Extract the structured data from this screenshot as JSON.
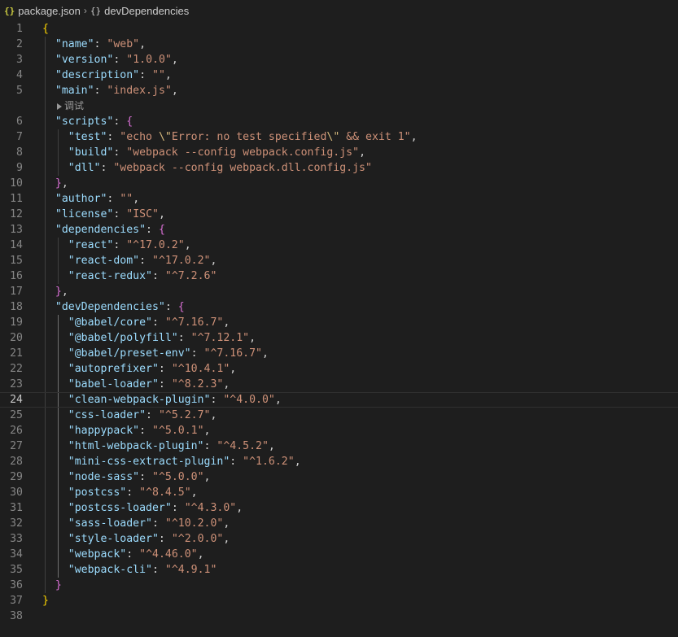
{
  "breadcrumb": {
    "file_icon": "{}",
    "file": "package.json",
    "separator": "›",
    "symbol_icon": "{}",
    "symbol": "devDependencies"
  },
  "codelens": "调试",
  "editor": {
    "current_line": 24,
    "lines": [
      {
        "n": "1",
        "t": [
          [
            "b1",
            "{"
          ]
        ]
      },
      {
        "n": "2",
        "t": [
          [
            "p",
            "  "
          ],
          [
            "k",
            "\"name\""
          ],
          [
            "p",
            ": "
          ],
          [
            "s",
            "\"web\""
          ],
          [
            "p",
            ","
          ]
        ]
      },
      {
        "n": "3",
        "t": [
          [
            "p",
            "  "
          ],
          [
            "k",
            "\"version\""
          ],
          [
            "p",
            ": "
          ],
          [
            "s",
            "\"1.0.0\""
          ],
          [
            "p",
            ","
          ]
        ]
      },
      {
        "n": "4",
        "t": [
          [
            "p",
            "  "
          ],
          [
            "k",
            "\"description\""
          ],
          [
            "p",
            ": "
          ],
          [
            "s",
            "\"\""
          ],
          [
            "p",
            ","
          ]
        ]
      },
      {
        "n": "5",
        "t": [
          [
            "p",
            "  "
          ],
          [
            "k",
            "\"main\""
          ],
          [
            "p",
            ": "
          ],
          [
            "s",
            "\"index.js\""
          ],
          [
            "p",
            ","
          ]
        ]
      },
      {
        "n": "6",
        "t": [
          [
            "p",
            "  "
          ],
          [
            "k",
            "\"scripts\""
          ],
          [
            "p",
            ": "
          ],
          [
            "b2",
            "{"
          ]
        ]
      },
      {
        "n": "7",
        "t": [
          [
            "p",
            "    "
          ],
          [
            "k",
            "\"test\""
          ],
          [
            "p",
            ": "
          ],
          [
            "s",
            "\"echo "
          ],
          [
            "e",
            "\\\""
          ],
          [
            "s",
            "Error: no test specified"
          ],
          [
            "e",
            "\\\""
          ],
          [
            "s",
            " && exit 1\""
          ],
          [
            "p",
            ","
          ]
        ]
      },
      {
        "n": "8",
        "t": [
          [
            "p",
            "    "
          ],
          [
            "k",
            "\"build\""
          ],
          [
            "p",
            ": "
          ],
          [
            "s",
            "\"webpack --config webpack.config.js\""
          ],
          [
            "p",
            ","
          ]
        ]
      },
      {
        "n": "9",
        "t": [
          [
            "p",
            "    "
          ],
          [
            "k",
            "\"dll\""
          ],
          [
            "p",
            ": "
          ],
          [
            "s",
            "\"webpack --config webpack.dll.config.js\""
          ]
        ]
      },
      {
        "n": "10",
        "t": [
          [
            "p",
            "  "
          ],
          [
            "b2",
            "}"
          ],
          [
            "p",
            ","
          ]
        ]
      },
      {
        "n": "11",
        "t": [
          [
            "p",
            "  "
          ],
          [
            "k",
            "\"author\""
          ],
          [
            "p",
            ": "
          ],
          [
            "s",
            "\"\""
          ],
          [
            "p",
            ","
          ]
        ]
      },
      {
        "n": "12",
        "t": [
          [
            "p",
            "  "
          ],
          [
            "k",
            "\"license\""
          ],
          [
            "p",
            ": "
          ],
          [
            "s",
            "\"ISC\""
          ],
          [
            "p",
            ","
          ]
        ]
      },
      {
        "n": "13",
        "t": [
          [
            "p",
            "  "
          ],
          [
            "k",
            "\"dependencies\""
          ],
          [
            "p",
            ": "
          ],
          [
            "b2",
            "{"
          ]
        ]
      },
      {
        "n": "14",
        "t": [
          [
            "p",
            "    "
          ],
          [
            "k",
            "\"react\""
          ],
          [
            "p",
            ": "
          ],
          [
            "s",
            "\"^17.0.2\""
          ],
          [
            "p",
            ","
          ]
        ]
      },
      {
        "n": "15",
        "t": [
          [
            "p",
            "    "
          ],
          [
            "k",
            "\"react-dom\""
          ],
          [
            "p",
            ": "
          ],
          [
            "s",
            "\"^17.0.2\""
          ],
          [
            "p",
            ","
          ]
        ]
      },
      {
        "n": "16",
        "t": [
          [
            "p",
            "    "
          ],
          [
            "k",
            "\"react-redux\""
          ],
          [
            "p",
            ": "
          ],
          [
            "s",
            "\"^7.2.6\""
          ]
        ]
      },
      {
        "n": "17",
        "t": [
          [
            "p",
            "  "
          ],
          [
            "b2",
            "}"
          ],
          [
            "p",
            ","
          ]
        ]
      },
      {
        "n": "18",
        "t": [
          [
            "p",
            "  "
          ],
          [
            "k",
            "\"devDependencies\""
          ],
          [
            "p",
            ": "
          ],
          [
            "b2",
            "{"
          ]
        ]
      },
      {
        "n": "19",
        "t": [
          [
            "p",
            "    "
          ],
          [
            "k",
            "\"@babel/core\""
          ],
          [
            "p",
            ": "
          ],
          [
            "s",
            "\"^7.16.7\""
          ],
          [
            "p",
            ","
          ]
        ]
      },
      {
        "n": "20",
        "t": [
          [
            "p",
            "    "
          ],
          [
            "k",
            "\"@babel/polyfill\""
          ],
          [
            "p",
            ": "
          ],
          [
            "s",
            "\"^7.12.1\""
          ],
          [
            "p",
            ","
          ]
        ]
      },
      {
        "n": "21",
        "t": [
          [
            "p",
            "    "
          ],
          [
            "k",
            "\"@babel/preset-env\""
          ],
          [
            "p",
            ": "
          ],
          [
            "s",
            "\"^7.16.7\""
          ],
          [
            "p",
            ","
          ]
        ]
      },
      {
        "n": "22",
        "t": [
          [
            "p",
            "    "
          ],
          [
            "k",
            "\"autoprefixer\""
          ],
          [
            "p",
            ": "
          ],
          [
            "s",
            "\"^10.4.1\""
          ],
          [
            "p",
            ","
          ]
        ]
      },
      {
        "n": "23",
        "t": [
          [
            "p",
            "    "
          ],
          [
            "k",
            "\"babel-loader\""
          ],
          [
            "p",
            ": "
          ],
          [
            "s",
            "\"^8.2.3\""
          ],
          [
            "p",
            ","
          ]
        ]
      },
      {
        "n": "24",
        "t": [
          [
            "p",
            "    "
          ],
          [
            "k",
            "\"clean-webpack-plugin\""
          ],
          [
            "p",
            ": "
          ],
          [
            "s",
            "\"^4.0.0\""
          ],
          [
            "p",
            ","
          ]
        ]
      },
      {
        "n": "25",
        "t": [
          [
            "p",
            "    "
          ],
          [
            "k",
            "\"css-loader\""
          ],
          [
            "p",
            ": "
          ],
          [
            "s",
            "\"^5.2.7\""
          ],
          [
            "p",
            ","
          ]
        ]
      },
      {
        "n": "26",
        "t": [
          [
            "p",
            "    "
          ],
          [
            "k",
            "\"happypack\""
          ],
          [
            "p",
            ": "
          ],
          [
            "s",
            "\"^5.0.1\""
          ],
          [
            "p",
            ","
          ]
        ]
      },
      {
        "n": "27",
        "t": [
          [
            "p",
            "    "
          ],
          [
            "k",
            "\"html-webpack-plugin\""
          ],
          [
            "p",
            ": "
          ],
          [
            "s",
            "\"^4.5.2\""
          ],
          [
            "p",
            ","
          ]
        ]
      },
      {
        "n": "28",
        "t": [
          [
            "p",
            "    "
          ],
          [
            "k",
            "\"mini-css-extract-plugin\""
          ],
          [
            "p",
            ": "
          ],
          [
            "s",
            "\"^1.6.2\""
          ],
          [
            "p",
            ","
          ]
        ]
      },
      {
        "n": "29",
        "t": [
          [
            "p",
            "    "
          ],
          [
            "k",
            "\"node-sass\""
          ],
          [
            "p",
            ": "
          ],
          [
            "s",
            "\"^5.0.0\""
          ],
          [
            "p",
            ","
          ]
        ]
      },
      {
        "n": "30",
        "t": [
          [
            "p",
            "    "
          ],
          [
            "k",
            "\"postcss\""
          ],
          [
            "p",
            ": "
          ],
          [
            "s",
            "\"^8.4.5\""
          ],
          [
            "p",
            ","
          ]
        ]
      },
      {
        "n": "31",
        "t": [
          [
            "p",
            "    "
          ],
          [
            "k",
            "\"postcss-loader\""
          ],
          [
            "p",
            ": "
          ],
          [
            "s",
            "\"^4.3.0\""
          ],
          [
            "p",
            ","
          ]
        ]
      },
      {
        "n": "32",
        "t": [
          [
            "p",
            "    "
          ],
          [
            "k",
            "\"sass-loader\""
          ],
          [
            "p",
            ": "
          ],
          [
            "s",
            "\"^10.2.0\""
          ],
          [
            "p",
            ","
          ]
        ]
      },
      {
        "n": "33",
        "t": [
          [
            "p",
            "    "
          ],
          [
            "k",
            "\"style-loader\""
          ],
          [
            "p",
            ": "
          ],
          [
            "s",
            "\"^2.0.0\""
          ],
          [
            "p",
            ","
          ]
        ]
      },
      {
        "n": "34",
        "t": [
          [
            "p",
            "    "
          ],
          [
            "k",
            "\"webpack\""
          ],
          [
            "p",
            ": "
          ],
          [
            "s",
            "\"^4.46.0\""
          ],
          [
            "p",
            ","
          ]
        ]
      },
      {
        "n": "35",
        "t": [
          [
            "p",
            "    "
          ],
          [
            "k",
            "\"webpack-cli\""
          ],
          [
            "p",
            ": "
          ],
          [
            "s",
            "\"^4.9.1\""
          ]
        ]
      },
      {
        "n": "36",
        "t": [
          [
            "p",
            "  "
          ],
          [
            "b2",
            "}"
          ]
        ]
      },
      {
        "n": "37",
        "t": [
          [
            "b1",
            "}"
          ]
        ]
      },
      {
        "n": "38",
        "t": []
      }
    ]
  },
  "colors": {
    "background": "#1e1e1e",
    "key": "#9cdcfe",
    "string": "#ce9178",
    "escape": "#d7ba7d",
    "bracket_level1": "#ffd700",
    "bracket_level2": "#da70d6",
    "line_number": "#858585"
  }
}
